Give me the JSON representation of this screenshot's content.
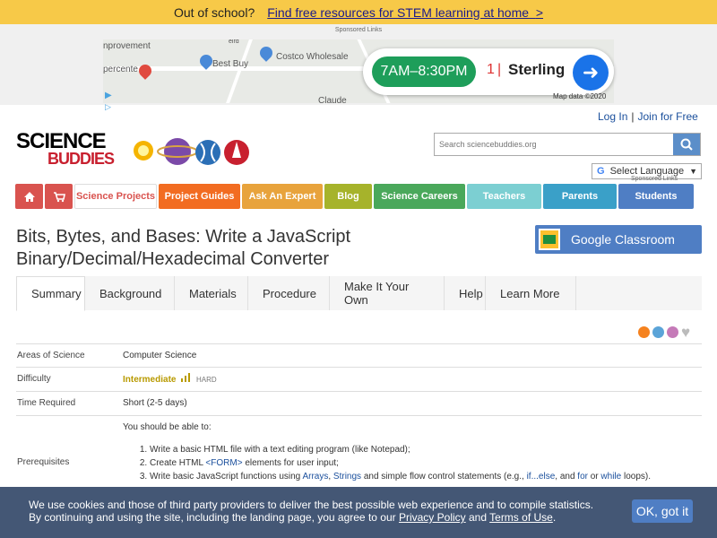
{
  "promo": {
    "question": "Out of school?",
    "link": "Find free resources for STEM learning at home",
    "arrow": ">"
  },
  "ad": {
    "sponsored_label": "Sponsored Links",
    "map_labels": [
      "nprovement",
      "Costco Wholesale",
      "Best Buy",
      "percente",
      "Claude",
      "elrd"
    ],
    "hours": "7AM–8:30PM",
    "distance": "1",
    "separator": "|",
    "town": "Sterling",
    "map_data": "Map data ©2020"
  },
  "auth": {
    "login": "Log In",
    "separator": "|",
    "join": "Join for Free"
  },
  "logo": {
    "line1": "SCIENCE",
    "line2": "BUDDIES",
    "registered": "®"
  },
  "search": {
    "placeholder": "Search sciencebuddies.org"
  },
  "language": {
    "g": "G",
    "label": "Select Language",
    "arrow": "▼",
    "sponsored": "Sponsored Links"
  },
  "nav": {
    "items": [
      {
        "label": "",
        "icon": "home-icon",
        "color": "#d9534f"
      },
      {
        "label": "",
        "icon": "cart-icon",
        "color": "#d9534f"
      },
      {
        "label": "Science Projects",
        "color": "#ffffff"
      },
      {
        "label": "Project Guides",
        "color": "#f26c21"
      },
      {
        "label": "Ask An Expert",
        "color": "#e8a33c"
      },
      {
        "label": "Blog",
        "color": "#a6b32b"
      },
      {
        "label": "Science Careers",
        "color": "#4aa85b"
      },
      {
        "label": "Teachers",
        "color": "#7ccfd2"
      },
      {
        "label": "Parents",
        "color": "#3aa0c8"
      },
      {
        "label": "Students",
        "color": "#4f7ec4"
      }
    ]
  },
  "page": {
    "title_line1": "Bits, Bytes, and Bases: Write a JavaScript",
    "title_line2": "Binary/Decimal/Hexadecimal Converter",
    "classroom_btn": "Google Classroom"
  },
  "tabs": [
    "Summary",
    "Background",
    "Materials",
    "Procedure",
    "Make It Your Own",
    "Help",
    "Learn More"
  ],
  "info": {
    "areas_label": "Areas of Science",
    "areas_value": "Computer Science",
    "difficulty_label": "Difficulty",
    "difficulty_value": "Intermediate",
    "difficulty_hard": "HARD",
    "time_label": "Time Required",
    "time_value": "Short (2-5 days)",
    "prereq_label": "Prerequisites",
    "prereq_intro": "You should be able to:",
    "prereq_1": "Write a basic HTML file with a text editing program (like Notepad);",
    "prereq_2a": "Create HTML ",
    "prereq_2b": "<FORM>",
    "prereq_2c": " elements for user input;",
    "prereq_3a": "Write basic JavaScript functions using ",
    "prereq_3b": "Arrays",
    "prereq_3c": ", ",
    "prereq_3d": "Strings",
    "prereq_3e": " and simple flow control statements (e.g., ",
    "prereq_3f": "if...else",
    "prereq_3g": ", and ",
    "prereq_3h": "for",
    "prereq_3i": " or ",
    "prereq_3j": "while",
    "prereq_3k": " loops)."
  },
  "cookie": {
    "line1": "We use cookies and those of third party providers to deliver the best possible web experience and to compile statistics.",
    "line2a": "By continuing and using the site, including the landing page, you agree to our ",
    "privacy": "Privacy Policy",
    "and": " and ",
    "terms": "Terms of Use",
    "period": ".",
    "ok": "OK, got it"
  }
}
